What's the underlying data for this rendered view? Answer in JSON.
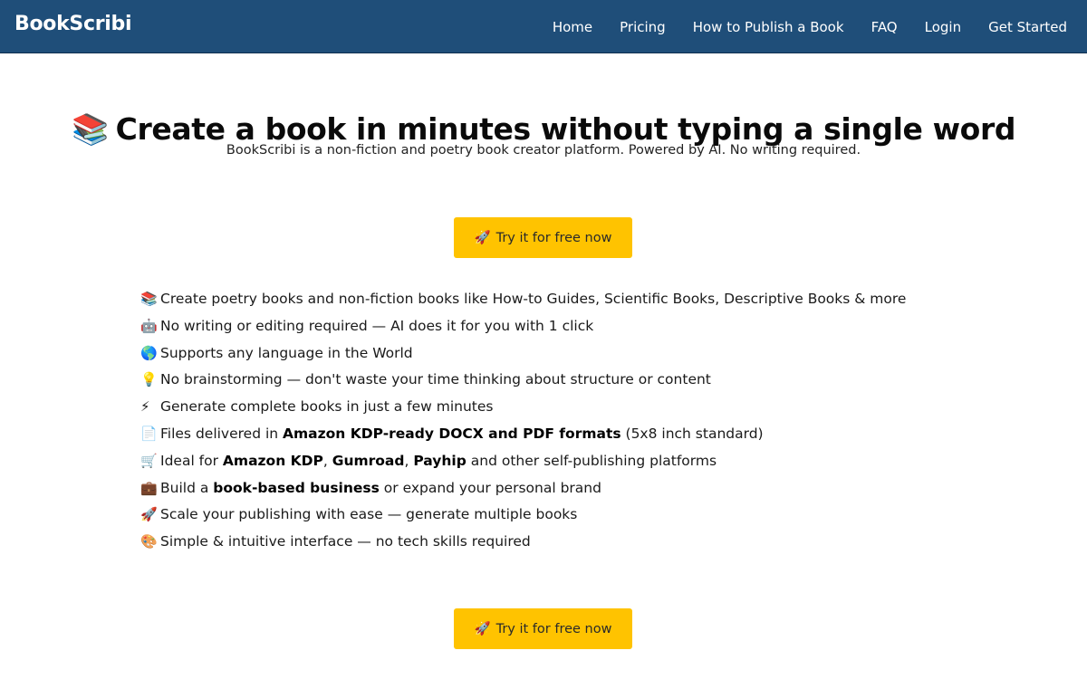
{
  "nav": {
    "brand": "BookScribi",
    "links": [
      "Home",
      "Pricing",
      "How to Publish a Book",
      "FAQ",
      "Login",
      "Get Started"
    ]
  },
  "hero": {
    "title_icon": "📚",
    "title": "Create a book in minutes without typing a single word",
    "subtitle": "BookScribi is a non-fiction and poetry book creator platform. Powered by AI. No writing required."
  },
  "cta": {
    "icon": "🚀",
    "label": "Try it for free now"
  },
  "features": [
    {
      "icon": "📚",
      "icon_name": "books-icon",
      "parts": [
        {
          "t": "Create poetry books and non-fiction books like How-to Guides, Scientific Books, Descriptive Books & more",
          "b": false
        }
      ]
    },
    {
      "icon": "🤖",
      "icon_name": "robot-icon",
      "parts": [
        {
          "t": "No writing or editing required — AI does it for you with 1 click",
          "b": false
        }
      ]
    },
    {
      "icon": "🌎",
      "icon_name": "globe-icon",
      "parts": [
        {
          "t": "Supports any language in the World",
          "b": false
        }
      ]
    },
    {
      "icon": "💡",
      "icon_name": "lightbulb-icon",
      "parts": [
        {
          "t": "No brainstorming — don't waste your time thinking about structure or content",
          "b": false
        }
      ]
    },
    {
      "icon": "⚡",
      "icon_name": "lightning-icon",
      "parts": [
        {
          "t": "Generate complete books in just a few minutes",
          "b": false
        }
      ]
    },
    {
      "icon": "📄",
      "icon_name": "document-icon",
      "parts": [
        {
          "t": "Files delivered in ",
          "b": false
        },
        {
          "t": "Amazon KDP-ready DOCX and PDF formats",
          "b": true
        },
        {
          "t": " (5x8 inch standard)",
          "b": false
        }
      ]
    },
    {
      "icon": "🛒",
      "icon_name": "cart-icon",
      "parts": [
        {
          "t": "Ideal for ",
          "b": false
        },
        {
          "t": "Amazon KDP",
          "b": true
        },
        {
          "t": ", ",
          "b": false
        },
        {
          "t": "Gumroad",
          "b": true
        },
        {
          "t": ", ",
          "b": false
        },
        {
          "t": "Payhip",
          "b": true
        },
        {
          "t": " and other self-publishing platforms",
          "b": false
        }
      ]
    },
    {
      "icon": "💼",
      "icon_name": "briefcase-icon",
      "parts": [
        {
          "t": "Build a ",
          "b": false
        },
        {
          "t": "book-based business",
          "b": true
        },
        {
          "t": " or expand your personal brand",
          "b": false
        }
      ]
    },
    {
      "icon": "🚀",
      "icon_name": "rocket-icon",
      "parts": [
        {
          "t": "Scale your publishing with ease — generate multiple books",
          "b": false
        }
      ]
    },
    {
      "icon": "🎨",
      "icon_name": "palette-icon",
      "parts": [
        {
          "t": "Simple & intuitive interface — no tech skills required",
          "b": false
        }
      ]
    }
  ],
  "colors": {
    "navbar": "#1f4e79",
    "cta": "#ffc300",
    "text": "#111111"
  }
}
